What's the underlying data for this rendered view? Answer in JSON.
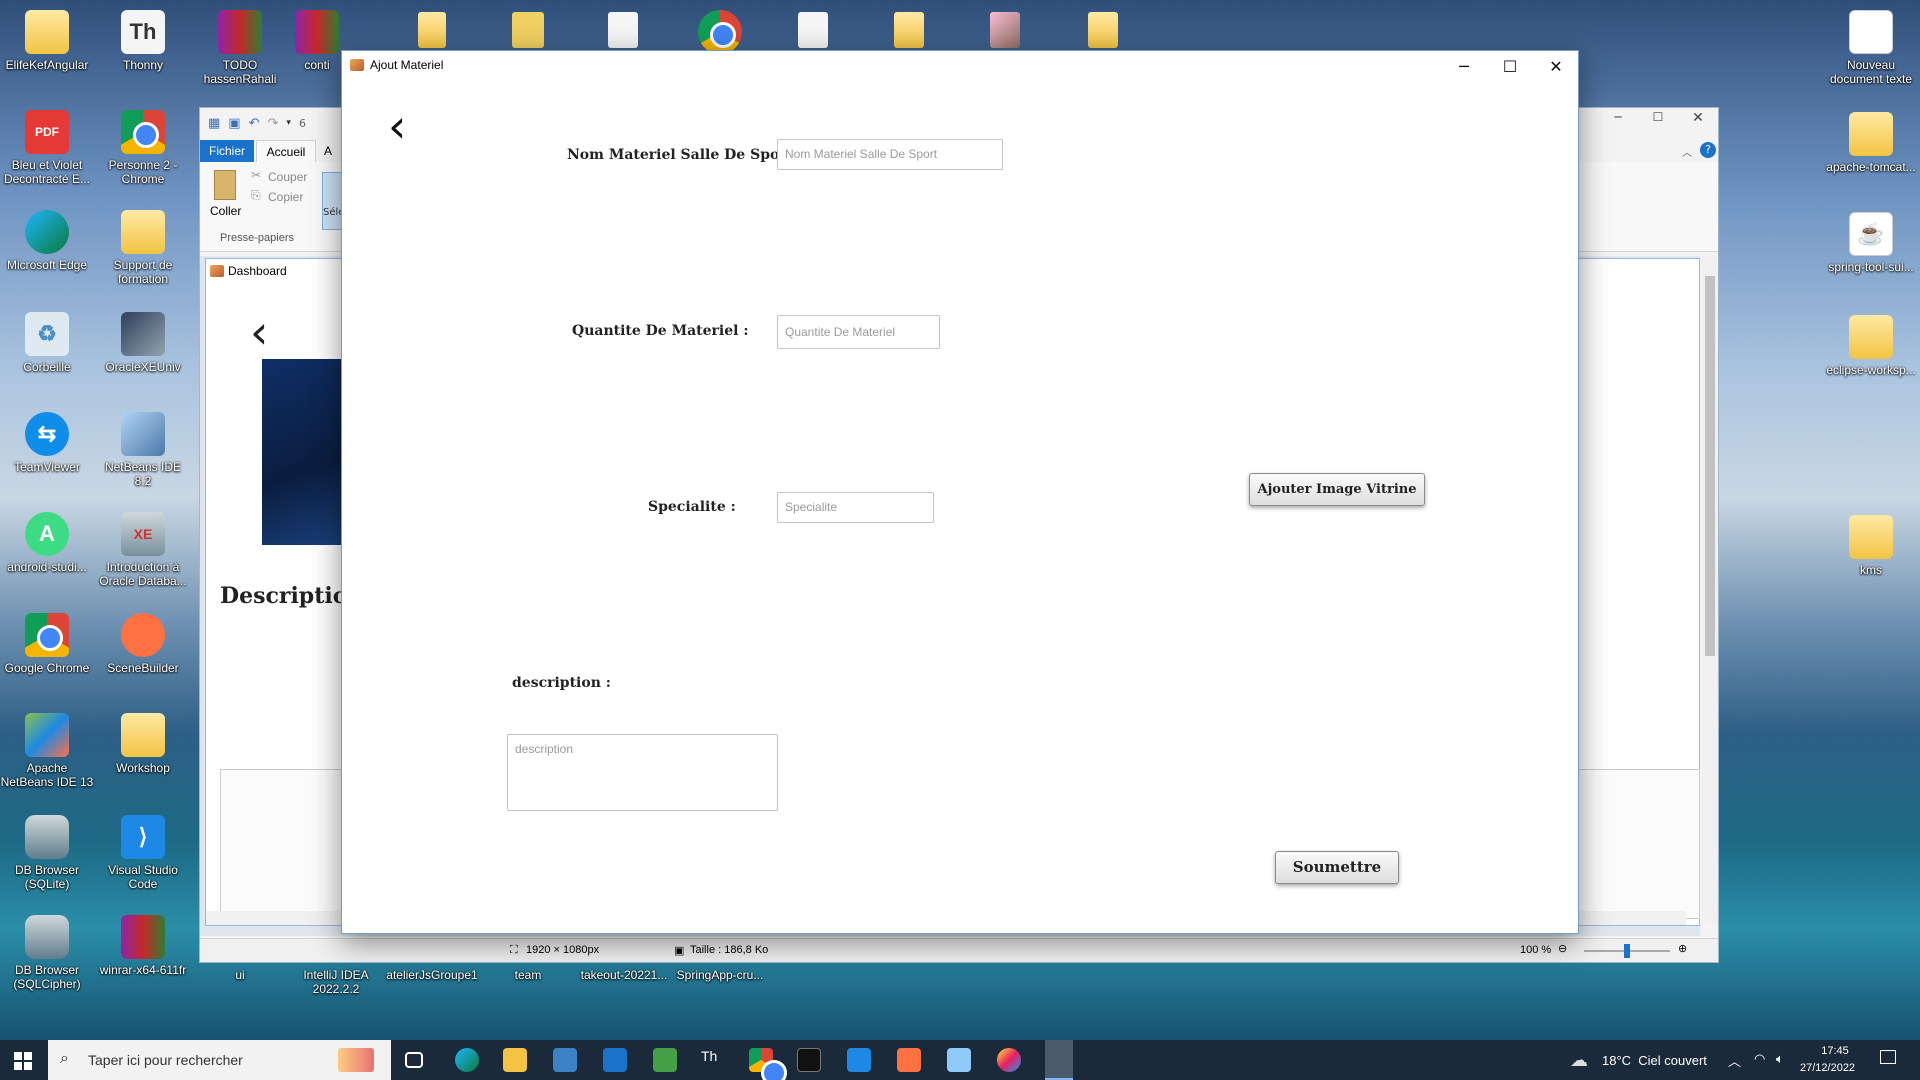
{
  "desktop": {
    "icons_left_col1": [
      "ElifeKefAngular",
      "Bleu et Violet Decontracté E...",
      "Microsoft Edge",
      "Corbeille",
      "TeamViewer",
      "android-studi...",
      "Google Chrome",
      "Apache NetBeans IDE 13",
      "DB Browser (SQLite)",
      "DB Browser (SQLCipher)"
    ],
    "icons_left_col2": [
      "Thonny",
      "Personne 2 - Chrome",
      "Support de formation",
      "OracleXEUniv",
      "NetBeans IDE 8.2",
      "Introduction à Oracle Databa...",
      "SceneBuilder",
      "Workshop",
      "Visual Studio Code",
      "winrar-x64-611fr"
    ],
    "icons_top": [
      "TODO hassenRahali",
      "conti"
    ],
    "icons_bottom_row": [
      "ui",
      "IntelliJ IDEA 2022.2.2",
      "atelierJsGroupe1",
      "team",
      "takeout-20221...",
      "SpringApp-cru..."
    ],
    "icons_right": [
      "Nouveau document texte",
      "apache-tomcat...",
      "spring-tool-sui...",
      "eclipse-worksp...",
      "kms"
    ]
  },
  "paint_window": {
    "quick_access_num": "6",
    "tabs": [
      "Fichier",
      "Accueil",
      "A"
    ],
    "clipboard": {
      "paste": "Coller",
      "cut": "Couper",
      "copy": "Copier",
      "group": "Presse-papiers",
      "select": "Séle"
    },
    "status": {
      "dimensions": "1920 × 1080px",
      "size": "Taille : 186,8 Ko",
      "zoom": "100 %"
    }
  },
  "dashboard_window": {
    "title": "Dashboard",
    "heading": "Descriptio"
  },
  "dialog": {
    "title": "Ajout Materiel",
    "nom_label": "Nom Materiel Salle De Sport :",
    "nom_placeholder": "Nom Materiel Salle De Sport",
    "quantite_label": "Quantite De Materiel :",
    "quantite_placeholder": "Quantite De Materiel",
    "specialite_label": "Specialite :",
    "specialite_placeholder": "Specialite",
    "description_label": "description :",
    "description_placeholder": "description",
    "image_button": "Ajouter Image Vitrine",
    "submit_button": "Soumettre"
  },
  "taskbar": {
    "search_placeholder": "Taper ici pour rechercher",
    "weather": "18°C  Ciel couvert",
    "time": "17:45",
    "date": "27/12/2022"
  },
  "colors": {
    "accent": "#1a73c8",
    "taskbar": "#1b2a3a"
  }
}
